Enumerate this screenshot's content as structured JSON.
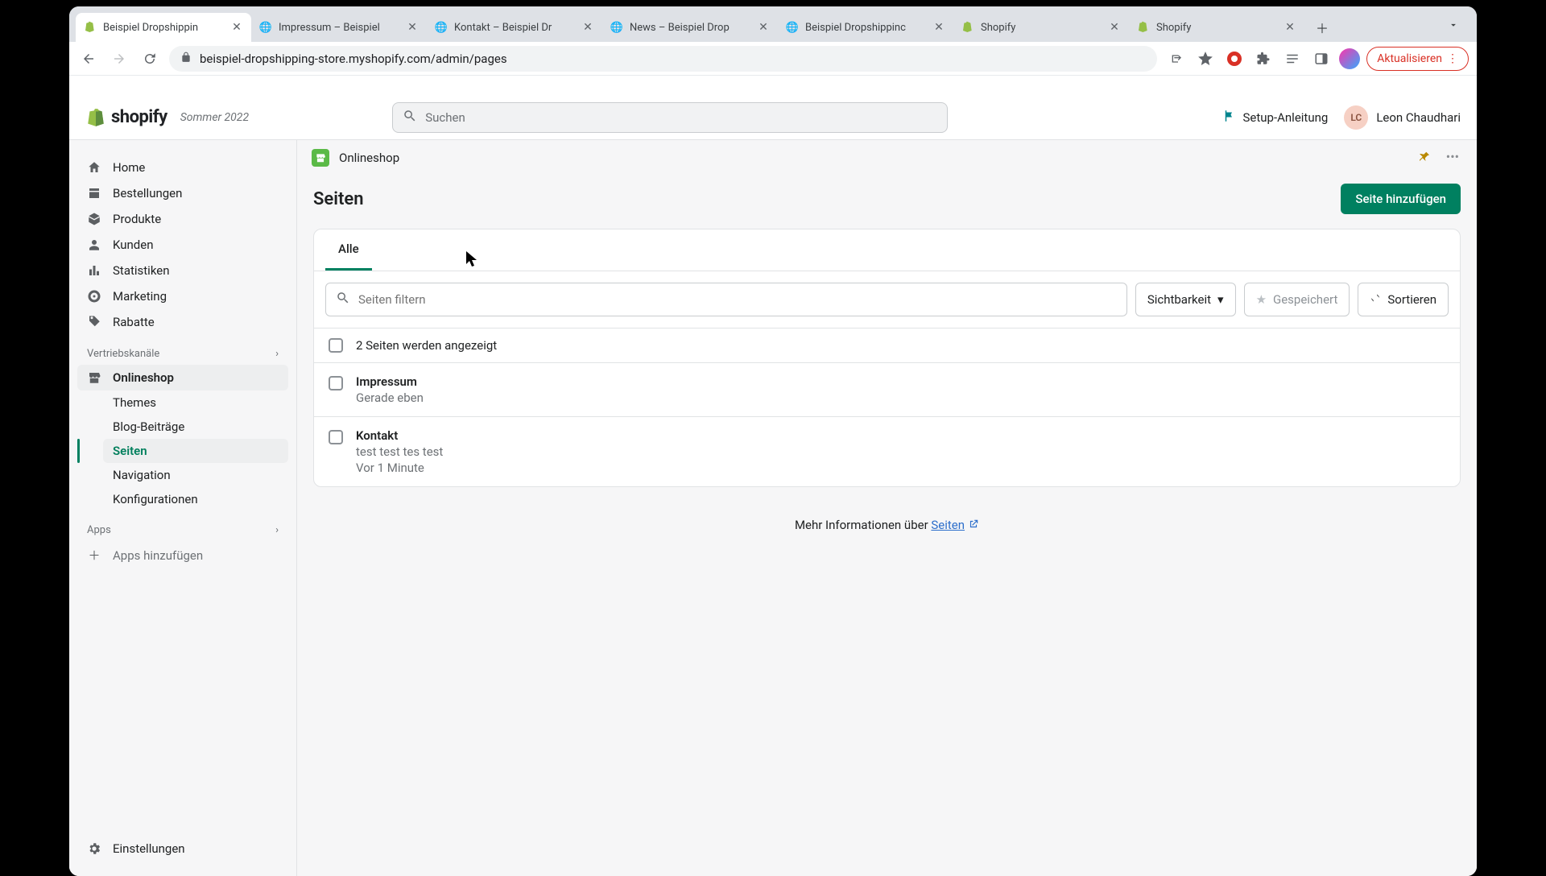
{
  "browser": {
    "tabs": [
      {
        "title": "Beispiel Dropshippin",
        "favicon": "shopify"
      },
      {
        "title": "Impressum – Beispiel",
        "favicon": "globe"
      },
      {
        "title": "Kontakt – Beispiel Dr",
        "favicon": "globe"
      },
      {
        "title": "News – Beispiel Drop",
        "favicon": "globe"
      },
      {
        "title": "Beispiel Dropshippinc",
        "favicon": "globe"
      },
      {
        "title": "Shopify",
        "favicon": "shopify"
      },
      {
        "title": "Shopify",
        "favicon": "shopify"
      }
    ],
    "url": "beispiel-dropshipping-store.myshopify.com/admin/pages",
    "update_label": "Aktualisieren"
  },
  "header": {
    "brand": "shopify",
    "badge": "Sommer 2022",
    "search_placeholder": "Suchen",
    "setup_label": "Setup-Anleitung",
    "user_initials": "LC",
    "user_name": "Leon Chaudhari"
  },
  "sidebar": {
    "items": [
      {
        "label": "Home",
        "icon": "home"
      },
      {
        "label": "Bestellungen",
        "icon": "orders"
      },
      {
        "label": "Produkte",
        "icon": "products"
      },
      {
        "label": "Kunden",
        "icon": "customers"
      },
      {
        "label": "Statistiken",
        "icon": "analytics"
      },
      {
        "label": "Marketing",
        "icon": "marketing"
      },
      {
        "label": "Rabatte",
        "icon": "discounts"
      }
    ],
    "section_channels": "Vertriebskanäle",
    "onlinestore": "Onlineshop",
    "sub": [
      {
        "label": "Themes"
      },
      {
        "label": "Blog-Beiträge"
      },
      {
        "label": "Seiten",
        "current": true
      },
      {
        "label": "Navigation"
      },
      {
        "label": "Konfigurationen"
      }
    ],
    "section_apps": "Apps",
    "add_apps": "Apps hinzufügen",
    "settings": "Einstellungen"
  },
  "main": {
    "crumb": "Onlineshop",
    "page_title": "Seiten",
    "primary_button": "Seite hinzufügen",
    "tab_all": "Alle",
    "filter_placeholder": "Seiten filtern",
    "visibility": "Sichtbarkeit",
    "saved": "Gespeichert",
    "sort": "Sortieren",
    "count_label": "2 Seiten werden angezeigt",
    "rows": [
      {
        "title": "Impressum",
        "sub": "Gerade eben"
      },
      {
        "title": "Kontakt",
        "sub": "test test tes test",
        "time": "Vor 1 Minute"
      }
    ],
    "footer_prefix": "Mehr Informationen über ",
    "footer_link": "Seiten"
  }
}
